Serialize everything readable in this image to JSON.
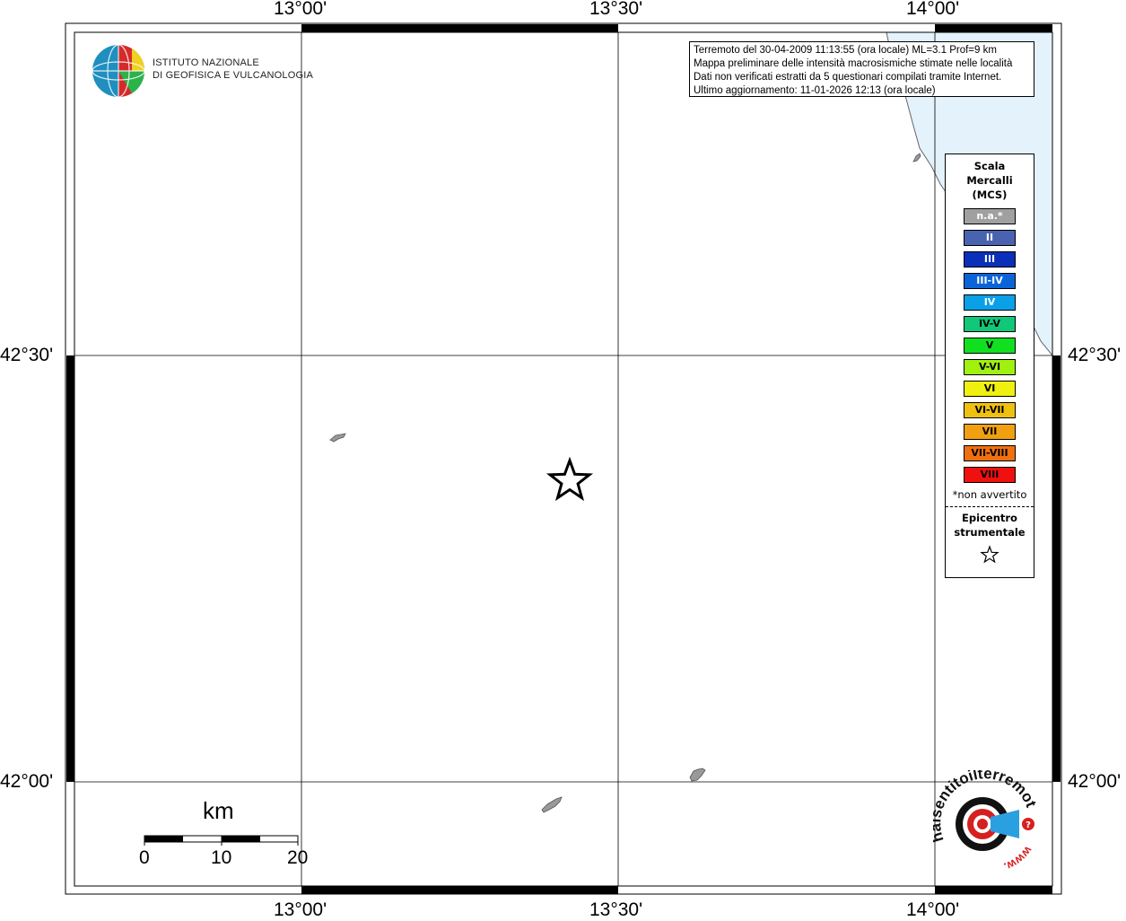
{
  "map": {
    "top_labels": [
      "13°00'",
      "13°30'",
      "14°00'"
    ],
    "bottom_labels": [
      "13°00'",
      "13°30'",
      "14°00'"
    ],
    "left_labels": [
      "42°30'",
      "42°00'"
    ],
    "right_labels": [
      "42°30'",
      "42°00'"
    ],
    "colors": {
      "sea": "#e3f2fb",
      "land": "#ffffff",
      "town": "#999999",
      "grid": "#000000"
    }
  },
  "info_box": {
    "lines": [
      "Terremoto del 30-04-2009 11:13:55 (ora locale) ML=3.1 Prof=9 km",
      "Mappa preliminare delle intensità macrosismiche stimate nelle località",
      "Dati non verificati estratti da 5 questionari compilati tramite Internet.",
      "Ultimo aggiornamento: 11-01-2026 12:13 (ora locale)"
    ]
  },
  "legend": {
    "title_lines": [
      "Scala",
      "Mercalli",
      "(MCS)"
    ],
    "items": [
      {
        "label": "n.a.*",
        "color": "#a0a0a0",
        "text_color": "#ffffff"
      },
      {
        "label": "II",
        "color": "#4a63b0",
        "text_color": "#ffffff"
      },
      {
        "label": "III",
        "color": "#0a2fb8",
        "text_color": "#ffffff"
      },
      {
        "label": "III-IV",
        "color": "#0a64d8",
        "text_color": "#ffffff"
      },
      {
        "label": "IV",
        "color": "#0aa0e8",
        "text_color": "#ffffff"
      },
      {
        "label": "IV-V",
        "color": "#10c878",
        "text_color": "#000000"
      },
      {
        "label": "V",
        "color": "#10e020",
        "text_color": "#000000"
      },
      {
        "label": "V-VI",
        "color": "#a0f010",
        "text_color": "#000000"
      },
      {
        "label": "VI",
        "color": "#f0f010",
        "text_color": "#000000"
      },
      {
        "label": "VI-VII",
        "color": "#f0c010",
        "text_color": "#000000"
      },
      {
        "label": "VII",
        "color": "#f0a010",
        "text_color": "#000000"
      },
      {
        "label": "VII-VIII",
        "color": "#f07010",
        "text_color": "#000000"
      },
      {
        "label": "VIII",
        "color": "#f01010",
        "text_color": "#000000"
      }
    ],
    "note": "*non avvertito",
    "epicenter_lines": [
      "Epicentro",
      "strumentale"
    ],
    "epicenter_icon": "star-outline-icon"
  },
  "ingv": {
    "line1": "ISTITUTO NAZIONALE",
    "line2": "DI GEOFISICA E VULCANOLOGIA"
  },
  "scale_bar": {
    "unit": "km",
    "labels": [
      "0",
      "10",
      "20"
    ]
  },
  "haisentito": {
    "text_arc": "haisentitoilterremoto.it",
    "text_www": "www."
  }
}
